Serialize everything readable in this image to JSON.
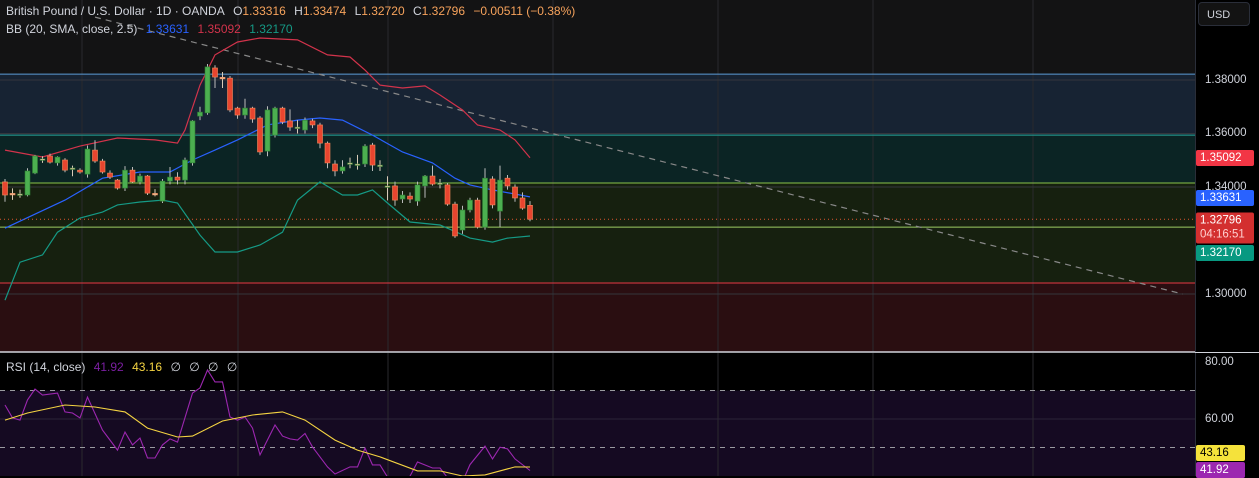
{
  "header": {
    "symbol": "British Pound / U.S. Dollar · 1D · OANDA",
    "o_label": "O",
    "o": "1.33316",
    "h_label": "H",
    "h": "1.33474",
    "l_label": "L",
    "l": "1.32720",
    "c_label": "C",
    "c": "1.32796",
    "change": "−0.00511 (−0.38%)"
  },
  "bb_legend": {
    "label": "BB (20, SMA, close, 2.5)",
    "basis": "1.33631",
    "upper": "1.35092",
    "lower": "1.32170"
  },
  "rsi_legend": {
    "label": "RSI (14, close)",
    "rsi": "41.92",
    "ma": "43.16",
    "extra": [
      "∅",
      "∅",
      "∅",
      "∅"
    ]
  },
  "currency_button": "USD",
  "price_axis": {
    "ticks": [
      "1.38000",
      "1.36000",
      "1.34000",
      "1.30000"
    ],
    "tick_values": [
      1.38,
      1.36,
      1.34,
      1.3
    ]
  },
  "price_tags": {
    "upper": "1.35092",
    "basis": "1.33631",
    "last": "1.32796",
    "countdown": "04:16:51",
    "lower": "1.32170"
  },
  "rsi_axis": {
    "ticks": [
      "80.00",
      "60.00"
    ],
    "tag_ma": "43.16",
    "tag_rsi": "41.92"
  },
  "colors": {
    "up": "#4caf50",
    "down": "#e8452f",
    "upper": "#d2334b",
    "basis": "#2962ff",
    "lower": "#159a86",
    "rsi": "#9c27b0",
    "rsi_ma": "#f5d442"
  },
  "chart_data": {
    "type": "candlestick",
    "candles_ohlc": [
      [
        1.3419,
        1.343,
        1.3345,
        1.337
      ],
      [
        1.3376,
        1.3395,
        1.3352,
        1.3374
      ],
      [
        1.3372,
        1.339,
        1.336,
        1.3374
      ],
      [
        1.337,
        1.347,
        1.3365,
        1.346
      ],
      [
        1.3452,
        1.352,
        1.3448,
        1.3516
      ],
      [
        1.3503,
        1.3515,
        1.349,
        1.3505
      ],
      [
        1.3516,
        1.3525,
        1.3488,
        1.3493
      ],
      [
        1.349,
        1.3515,
        1.348,
        1.3512
      ],
      [
        1.3501,
        1.3508,
        1.3455,
        1.3463
      ],
      [
        1.3469,
        1.348,
        1.344,
        1.3471
      ],
      [
        1.3463,
        1.347,
        1.345,
        1.3456
      ],
      [
        1.3448,
        1.3555,
        1.3435,
        1.3542
      ],
      [
        1.3538,
        1.3575,
        1.349,
        1.3497
      ],
      [
        1.3497,
        1.3505,
        1.345,
        1.3456
      ],
      [
        1.3452,
        1.3462,
        1.343,
        1.3437
      ],
      [
        1.3426,
        1.343,
        1.339,
        1.3396
      ],
      [
        1.3396,
        1.3478,
        1.3385,
        1.3463
      ],
      [
        1.3463,
        1.3475,
        1.3415,
        1.3419
      ],
      [
        1.3419,
        1.345,
        1.341,
        1.3441
      ],
      [
        1.3441,
        1.3445,
        1.337,
        1.3377
      ],
      [
        1.3376,
        1.3392,
        1.3365,
        1.3374
      ],
      [
        1.3347,
        1.343,
        1.334,
        1.3422
      ],
      [
        1.3422,
        1.3475,
        1.341,
        1.3437
      ],
      [
        1.3437,
        1.3455,
        1.341,
        1.3426
      ],
      [
        1.3426,
        1.351,
        1.341,
        1.3501
      ],
      [
        1.349,
        1.365,
        1.348,
        1.3647
      ],
      [
        1.3665,
        1.37,
        1.365,
        1.368
      ],
      [
        1.3677,
        1.386,
        1.367,
        1.3849
      ],
      [
        1.3845,
        1.3855,
        1.377,
        1.3811
      ],
      [
        1.381,
        1.383,
        1.377,
        1.3807
      ],
      [
        1.3807,
        1.3815,
        1.368,
        1.3688
      ],
      [
        1.3695,
        1.37,
        1.3655,
        1.3669
      ],
      [
        1.3669,
        1.373,
        1.3655,
        1.3695
      ],
      [
        1.3695,
        1.37,
        1.364,
        1.3654
      ],
      [
        1.3658,
        1.3665,
        1.352,
        1.3531
      ],
      [
        1.3534,
        1.3702,
        1.3515,
        1.3688
      ],
      [
        1.3594,
        1.37,
        1.3585,
        1.3695
      ],
      [
        1.3695,
        1.37,
        1.3635,
        1.3643
      ],
      [
        1.3647,
        1.369,
        1.361,
        1.3624
      ],
      [
        1.3622,
        1.365,
        1.36,
        1.3624
      ],
      [
        1.3613,
        1.366,
        1.36,
        1.365
      ],
      [
        1.3647,
        1.3655,
        1.362,
        1.3632
      ],
      [
        1.3632,
        1.364,
        1.3545,
        1.3564
      ],
      [
        1.3564,
        1.357,
        1.347,
        1.349
      ],
      [
        1.3486,
        1.35,
        1.344,
        1.346
      ],
      [
        1.346,
        1.35,
        1.345,
        1.3475
      ],
      [
        1.3488,
        1.351,
        1.347,
        1.349
      ],
      [
        1.3484,
        1.352,
        1.3465,
        1.3486
      ],
      [
        1.3486,
        1.356,
        1.3475,
        1.3553
      ],
      [
        1.3557,
        1.3565,
        1.346,
        1.3482
      ],
      [
        1.348,
        1.35,
        1.346,
        1.3482
      ],
      [
        1.3402,
        1.344,
        1.335,
        1.3404
      ],
      [
        1.3404,
        1.342,
        1.333,
        1.3351
      ],
      [
        1.3355,
        1.3385,
        1.334,
        1.337
      ],
      [
        1.3366,
        1.338,
        1.334,
        1.3355
      ],
      [
        1.3347,
        1.342,
        1.333,
        1.3408
      ],
      [
        1.3404,
        1.3445,
        1.336,
        1.3441
      ],
      [
        1.3441,
        1.348,
        1.3405,
        1.3411
      ],
      [
        1.3413,
        1.343,
        1.3395,
        1.3415
      ],
      [
        1.3408,
        1.3415,
        1.333,
        1.3336
      ],
      [
        1.3336,
        1.3345,
        1.321,
        1.3217
      ],
      [
        1.3239,
        1.333,
        1.3225,
        1.3314
      ],
      [
        1.3314,
        1.336,
        1.3305,
        1.3351
      ],
      [
        1.3351,
        1.336,
        1.3245,
        1.325
      ],
      [
        1.325,
        1.347,
        1.324,
        1.3433
      ],
      [
        1.343,
        1.344,
        1.332,
        1.3333
      ],
      [
        1.331,
        1.348,
        1.325,
        1.3426
      ],
      [
        1.3433,
        1.3445,
        1.339,
        1.3404
      ],
      [
        1.34,
        1.341,
        1.3345,
        1.3359
      ],
      [
        1.3359,
        1.338,
        1.3315,
        1.3321
      ],
      [
        1.33316,
        1.33474,
        1.3272,
        1.32796
      ]
    ],
    "bb_upper": [
      [
        0,
        1.3538
      ],
      [
        5,
        1.3512
      ],
      [
        10,
        1.3553
      ],
      [
        15,
        1.3583
      ],
      [
        20,
        1.3576
      ],
      [
        23,
        1.3564
      ],
      [
        24,
        1.3613
      ],
      [
        26,
        1.3781
      ],
      [
        28,
        1.3894
      ],
      [
        31,
        1.3942
      ],
      [
        34,
        1.3957
      ],
      [
        39,
        1.395
      ],
      [
        43,
        1.3894
      ],
      [
        46,
        1.3886
      ],
      [
        48,
        1.3837
      ],
      [
        50,
        1.3781
      ],
      [
        53,
        1.377
      ],
      [
        56,
        1.3778
      ],
      [
        58,
        1.3744
      ],
      [
        61,
        1.3688
      ],
      [
        63,
        1.3632
      ],
      [
        66,
        1.3613
      ],
      [
        68,
        1.3576
      ],
      [
        70,
        1.35092
      ]
    ],
    "bb_basis": [
      [
        0,
        1.3246
      ],
      [
        8,
        1.3351
      ],
      [
        13,
        1.3433
      ],
      [
        18,
        1.3456
      ],
      [
        22,
        1.3456
      ],
      [
        25,
        1.3501
      ],
      [
        28,
        1.3538
      ],
      [
        31,
        1.3576
      ],
      [
        35,
        1.3632
      ],
      [
        39,
        1.365
      ],
      [
        42,
        1.3658
      ],
      [
        45,
        1.365
      ],
      [
        49,
        1.3594
      ],
      [
        53,
        1.3531
      ],
      [
        57,
        1.349
      ],
      [
        60,
        1.3433
      ],
      [
        62,
        1.3408
      ],
      [
        65,
        1.3389
      ],
      [
        70,
        1.33631
      ]
    ],
    "bb_lower": [
      [
        0,
        1.2977
      ],
      [
        2,
        1.3119
      ],
      [
        5,
        1.3146
      ],
      [
        7,
        1.3231
      ],
      [
        10,
        1.3284
      ],
      [
        13,
        1.3306
      ],
      [
        15,
        1.3333
      ],
      [
        18,
        1.3344
      ],
      [
        21,
        1.3351
      ],
      [
        23,
        1.334
      ],
      [
        26,
        1.322
      ],
      [
        28,
        1.3157
      ],
      [
        31,
        1.3157
      ],
      [
        34,
        1.3183
      ],
      [
        37,
        1.3231
      ],
      [
        39,
        1.3351
      ],
      [
        42,
        1.3419
      ],
      [
        45,
        1.337
      ],
      [
        47,
        1.337
      ],
      [
        49,
        1.3389
      ],
      [
        51,
        1.334
      ],
      [
        54,
        1.3269
      ],
      [
        58,
        1.3258
      ],
      [
        62,
        1.3209
      ],
      [
        65,
        1.3194
      ],
      [
        67,
        1.3209
      ],
      [
        70,
        1.3217
      ]
    ],
    "levels": [
      1.3822,
      1.3594,
      1.3415,
      1.325,
      1.3041
    ],
    "last_price": 1.32796,
    "trendline": [
      [
        12,
        1.4035
      ],
      [
        157,
        1.3
      ]
    ],
    "rsi": [
      [
        0,
        64.9
      ],
      [
        1,
        60.4
      ],
      [
        2,
        59.6
      ],
      [
        3,
        66.7
      ],
      [
        4,
        70.5
      ],
      [
        5,
        68.4
      ],
      [
        7,
        69.1
      ],
      [
        8,
        62.5
      ],
      [
        9,
        62.1
      ],
      [
        10,
        60.4
      ],
      [
        11,
        67.7
      ],
      [
        13,
        56.1
      ],
      [
        15,
        49.1
      ],
      [
        16,
        55.4
      ],
      [
        17,
        50.9
      ],
      [
        18,
        53.3
      ],
      [
        19,
        46.3
      ],
      [
        20,
        46.3
      ],
      [
        21,
        50.9
      ],
      [
        22,
        53.0
      ],
      [
        23,
        51.9
      ],
      [
        25,
        69.1
      ],
      [
        26,
        70.9
      ],
      [
        27,
        77.2
      ],
      [
        28,
        73.0
      ],
      [
        29,
        73.0
      ],
      [
        30,
        60.7
      ],
      [
        31,
        59.6
      ],
      [
        32,
        60.7
      ],
      [
        33,
        56.8
      ],
      [
        34,
        47.4
      ],
      [
        36,
        57.9
      ],
      [
        37,
        54.0
      ],
      [
        38,
        53.0
      ],
      [
        39,
        52.6
      ],
      [
        40,
        54.9
      ],
      [
        41,
        50.2
      ],
      [
        43,
        43.2
      ],
      [
        44,
        40.7
      ],
      [
        46,
        43.2
      ],
      [
        47,
        43.2
      ],
      [
        48,
        49.8
      ],
      [
        49,
        43.9
      ],
      [
        50,
        43.9
      ],
      [
        51,
        39.6
      ],
      [
        53,
        35.0
      ],
      [
        55,
        44.9
      ],
      [
        57,
        42.8
      ],
      [
        58,
        42.8
      ],
      [
        60,
        36.0
      ],
      [
        61,
        38.0
      ],
      [
        62,
        44.0
      ],
      [
        64,
        50.5
      ],
      [
        65,
        46.0
      ],
      [
        66,
        50.1
      ],
      [
        67,
        49.5
      ],
      [
        68,
        46.0
      ],
      [
        70,
        41.92
      ]
    ],
    "rsi_ma": [
      [
        0,
        59.6
      ],
      [
        3,
        62.1
      ],
      [
        8,
        64.9
      ],
      [
        12,
        64.2
      ],
      [
        16,
        62.5
      ],
      [
        19,
        56.8
      ],
      [
        23,
        53.7
      ],
      [
        25,
        54.0
      ],
      [
        29,
        59.3
      ],
      [
        33,
        61.4
      ],
      [
        37,
        62.5
      ],
      [
        40,
        59.6
      ],
      [
        44,
        52.6
      ],
      [
        47,
        49.1
      ],
      [
        50,
        46.7
      ],
      [
        55,
        41.8
      ],
      [
        58,
        41.8
      ],
      [
        61,
        40.0
      ],
      [
        64,
        40.4
      ],
      [
        68,
        43.2
      ],
      [
        70,
        43.16
      ]
    ],
    "rsi_levels": [
      70,
      50
    ],
    "rsi_range": [
      80,
      60
    ]
  }
}
